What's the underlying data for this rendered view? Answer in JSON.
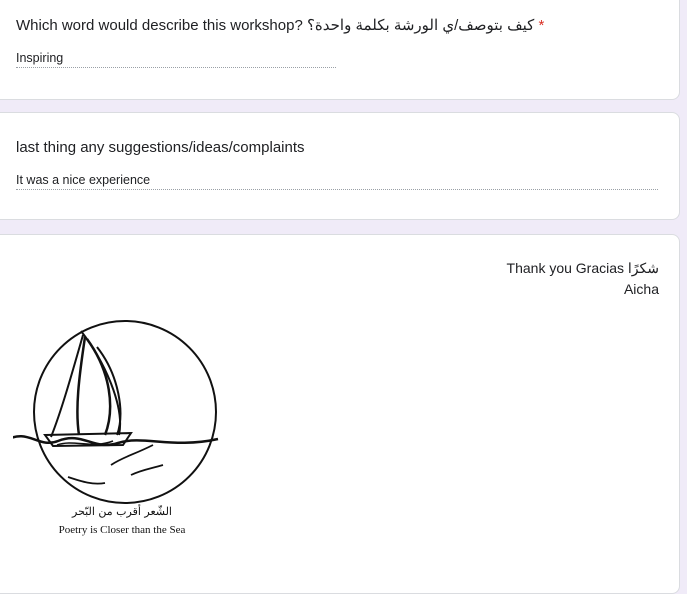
{
  "questions": [
    {
      "title": "Which word would describe this workshop? كيف بتوصف/ي الورشة بكلمة واحدة؟",
      "required_mark": "*",
      "answer": "Inspiring"
    },
    {
      "title": "last thing any suggestions/ideas/complaints",
      "answer": "It was a nice experience"
    }
  ],
  "closing": {
    "line1": "Thank you Gracias شكرًا",
    "line2": "Aicha"
  },
  "logo": {
    "arabic_text": "الشّعر أقرب من البّحر",
    "english_text": "Poetry is Closer than the Sea"
  },
  "colors": {
    "background": "#f0ebf8",
    "required": "#d93025",
    "text": "#202124"
  }
}
